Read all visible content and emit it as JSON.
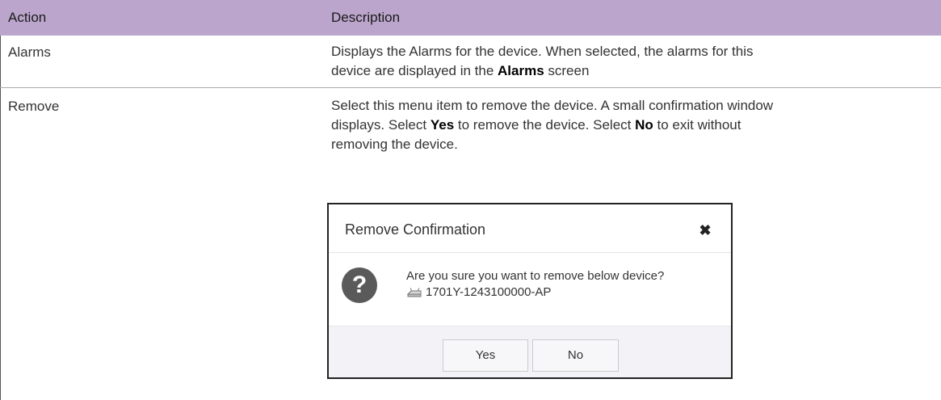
{
  "table": {
    "headers": {
      "action": "Action",
      "description": "Description"
    },
    "rows": [
      {
        "action": "Alarms",
        "desc_parts": [
          "Displays the Alarms for the device. When selected, the alarms for this",
          "device are displayed in the ",
          "Alarms",
          " screen"
        ]
      },
      {
        "action": "Remove",
        "desc_parts": [
          "Select this menu item to remove the device. A small confirmation window",
          "displays. Select ",
          "Yes",
          " to remove the device. Select ",
          "No",
          " to exit without",
          "removing the device."
        ]
      }
    ]
  },
  "dialog": {
    "title": "Remove Confirmation",
    "close_glyph": "✖",
    "icon": "question-circle-icon",
    "message": "Are you sure you want to remove below device?",
    "device_icon": "access-point-icon",
    "device_name": "1701Y-1243100000-AP",
    "yes_label": "Yes",
    "no_label": "No"
  },
  "colors": {
    "header_bg": "#bca5cc",
    "row_divider": "#a9a9a9",
    "dialog_footer_bg": "#f3f2f7",
    "question_icon_bg": "#5a5a5a"
  }
}
